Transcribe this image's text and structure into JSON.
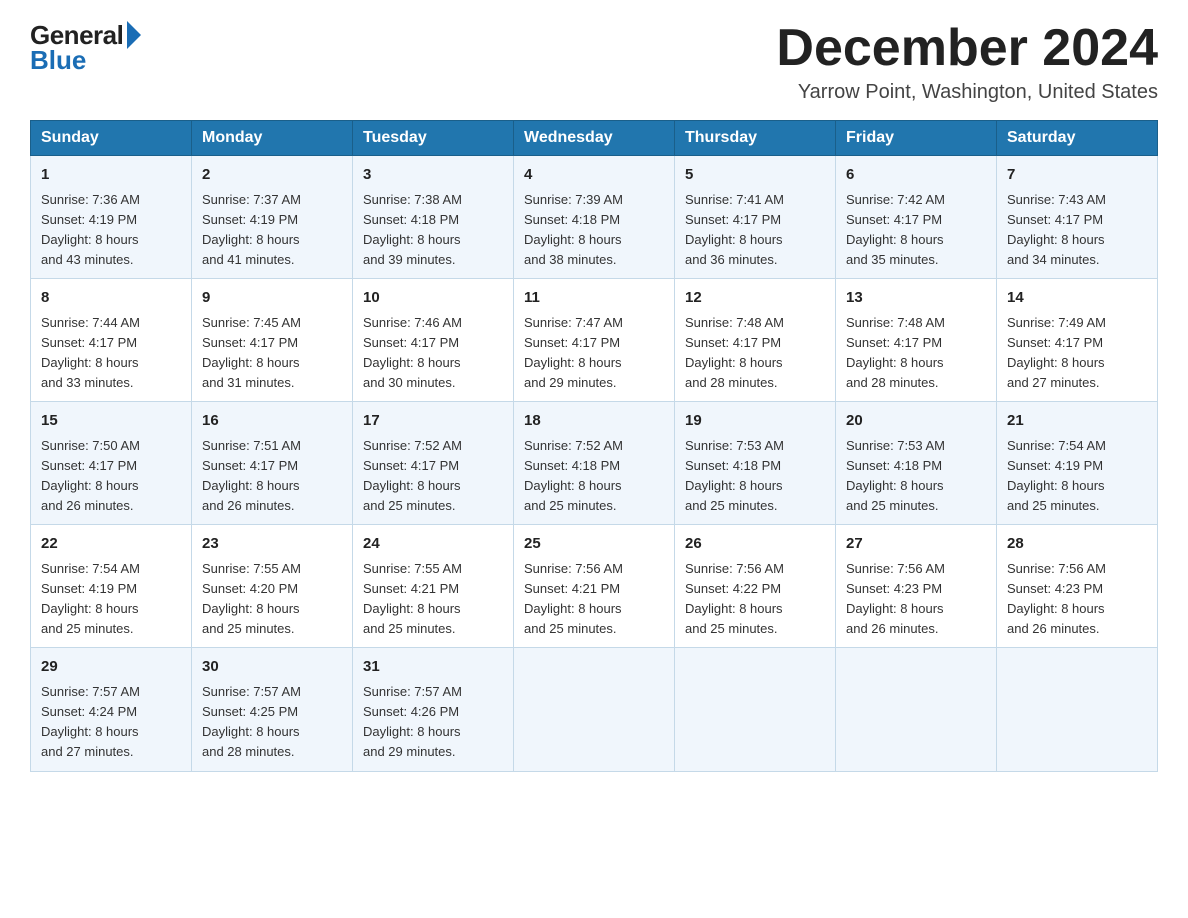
{
  "logo": {
    "general": "General",
    "blue": "Blue"
  },
  "title": "December 2024",
  "location": "Yarrow Point, Washington, United States",
  "days_of_week": [
    "Sunday",
    "Monday",
    "Tuesday",
    "Wednesday",
    "Thursday",
    "Friday",
    "Saturday"
  ],
  "weeks": [
    [
      {
        "day": "1",
        "sunrise": "7:36 AM",
        "sunset": "4:19 PM",
        "daylight": "8 hours and 43 minutes."
      },
      {
        "day": "2",
        "sunrise": "7:37 AM",
        "sunset": "4:19 PM",
        "daylight": "8 hours and 41 minutes."
      },
      {
        "day": "3",
        "sunrise": "7:38 AM",
        "sunset": "4:18 PM",
        "daylight": "8 hours and 39 minutes."
      },
      {
        "day": "4",
        "sunrise": "7:39 AM",
        "sunset": "4:18 PM",
        "daylight": "8 hours and 38 minutes."
      },
      {
        "day": "5",
        "sunrise": "7:41 AM",
        "sunset": "4:17 PM",
        "daylight": "8 hours and 36 minutes."
      },
      {
        "day": "6",
        "sunrise": "7:42 AM",
        "sunset": "4:17 PM",
        "daylight": "8 hours and 35 minutes."
      },
      {
        "day": "7",
        "sunrise": "7:43 AM",
        "sunset": "4:17 PM",
        "daylight": "8 hours and 34 minutes."
      }
    ],
    [
      {
        "day": "8",
        "sunrise": "7:44 AM",
        "sunset": "4:17 PM",
        "daylight": "8 hours and 33 minutes."
      },
      {
        "day": "9",
        "sunrise": "7:45 AM",
        "sunset": "4:17 PM",
        "daylight": "8 hours and 31 minutes."
      },
      {
        "day": "10",
        "sunrise": "7:46 AM",
        "sunset": "4:17 PM",
        "daylight": "8 hours and 30 minutes."
      },
      {
        "day": "11",
        "sunrise": "7:47 AM",
        "sunset": "4:17 PM",
        "daylight": "8 hours and 29 minutes."
      },
      {
        "day": "12",
        "sunrise": "7:48 AM",
        "sunset": "4:17 PM",
        "daylight": "8 hours and 28 minutes."
      },
      {
        "day": "13",
        "sunrise": "7:48 AM",
        "sunset": "4:17 PM",
        "daylight": "8 hours and 28 minutes."
      },
      {
        "day": "14",
        "sunrise": "7:49 AM",
        "sunset": "4:17 PM",
        "daylight": "8 hours and 27 minutes."
      }
    ],
    [
      {
        "day": "15",
        "sunrise": "7:50 AM",
        "sunset": "4:17 PM",
        "daylight": "8 hours and 26 minutes."
      },
      {
        "day": "16",
        "sunrise": "7:51 AM",
        "sunset": "4:17 PM",
        "daylight": "8 hours and 26 minutes."
      },
      {
        "day": "17",
        "sunrise": "7:52 AM",
        "sunset": "4:17 PM",
        "daylight": "8 hours and 25 minutes."
      },
      {
        "day": "18",
        "sunrise": "7:52 AM",
        "sunset": "4:18 PM",
        "daylight": "8 hours and 25 minutes."
      },
      {
        "day": "19",
        "sunrise": "7:53 AM",
        "sunset": "4:18 PM",
        "daylight": "8 hours and 25 minutes."
      },
      {
        "day": "20",
        "sunrise": "7:53 AM",
        "sunset": "4:18 PM",
        "daylight": "8 hours and 25 minutes."
      },
      {
        "day": "21",
        "sunrise": "7:54 AM",
        "sunset": "4:19 PM",
        "daylight": "8 hours and 25 minutes."
      }
    ],
    [
      {
        "day": "22",
        "sunrise": "7:54 AM",
        "sunset": "4:19 PM",
        "daylight": "8 hours and 25 minutes."
      },
      {
        "day": "23",
        "sunrise": "7:55 AM",
        "sunset": "4:20 PM",
        "daylight": "8 hours and 25 minutes."
      },
      {
        "day": "24",
        "sunrise": "7:55 AM",
        "sunset": "4:21 PM",
        "daylight": "8 hours and 25 minutes."
      },
      {
        "day": "25",
        "sunrise": "7:56 AM",
        "sunset": "4:21 PM",
        "daylight": "8 hours and 25 minutes."
      },
      {
        "day": "26",
        "sunrise": "7:56 AM",
        "sunset": "4:22 PM",
        "daylight": "8 hours and 25 minutes."
      },
      {
        "day": "27",
        "sunrise": "7:56 AM",
        "sunset": "4:23 PM",
        "daylight": "8 hours and 26 minutes."
      },
      {
        "day": "28",
        "sunrise": "7:56 AM",
        "sunset": "4:23 PM",
        "daylight": "8 hours and 26 minutes."
      }
    ],
    [
      {
        "day": "29",
        "sunrise": "7:57 AM",
        "sunset": "4:24 PM",
        "daylight": "8 hours and 27 minutes."
      },
      {
        "day": "30",
        "sunrise": "7:57 AM",
        "sunset": "4:25 PM",
        "daylight": "8 hours and 28 minutes."
      },
      {
        "day": "31",
        "sunrise": "7:57 AM",
        "sunset": "4:26 PM",
        "daylight": "8 hours and 29 minutes."
      },
      null,
      null,
      null,
      null
    ]
  ],
  "labels": {
    "sunrise": "Sunrise:",
    "sunset": "Sunset:",
    "daylight": "Daylight:"
  }
}
